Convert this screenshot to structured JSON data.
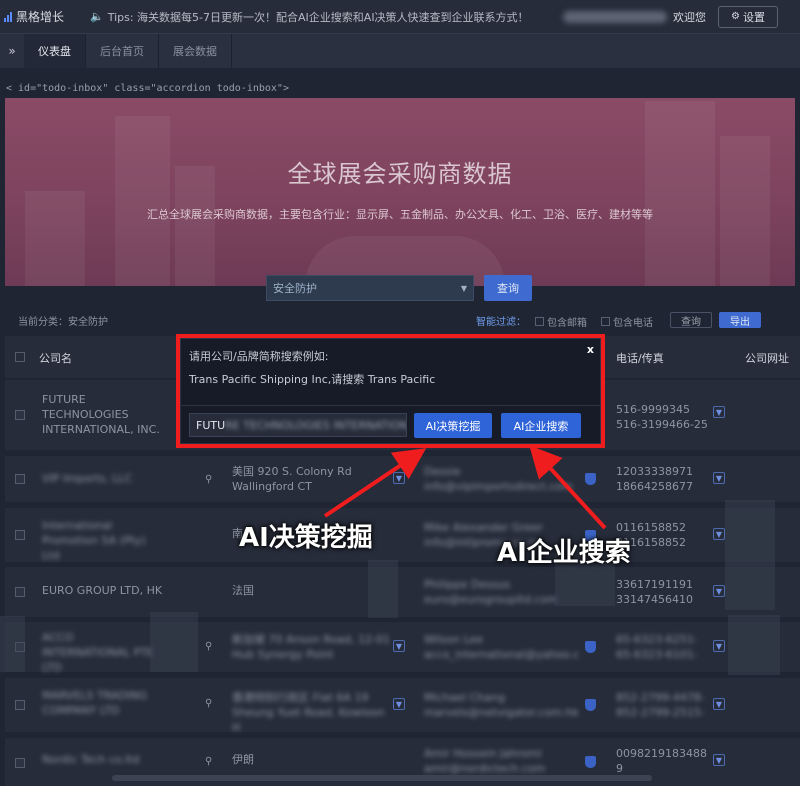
{
  "header": {
    "logo": "黑格增长",
    "tips": "Tips: 海关数据每5-7日更新一次！配合AI企业搜索和AI决策人快速查到企业联系方式！",
    "welcome": "欢迎您",
    "settings_label": "设置"
  },
  "tabs": {
    "toggle": "»",
    "items": [
      {
        "label": "仪表盘"
      },
      {
        "label": "后台首页"
      },
      {
        "label": "展会数据"
      }
    ]
  },
  "code_crumb": "< id=\"todo-inbox\" class=\"accordion todo-inbox\">",
  "banner": {
    "title": "全球展会采购商数据",
    "subtitle": "汇总全球展会采购商数据，主要包含行业：显示屏、五金制品、办公文具、化工、卫浴、医疗、建材等等"
  },
  "search": {
    "selected": "安全防护",
    "query_label": "查询"
  },
  "filter": {
    "current_category": "当前分类：安全防护",
    "smart_filter": "智能过滤：",
    "include_email": "包含邮箱",
    "include_phone": "包含电话",
    "query_label": "查询",
    "export_label": "导出"
  },
  "table": {
    "columns": {
      "company": "公司名",
      "phone": "电话/传真",
      "website": "公司网址"
    },
    "rows": [
      {
        "name": "FUTURE TECHNOLOGIES INTERNATIONAL, INC.",
        "address": "",
        "contact": "",
        "phone": "516-9999345\n516-3199466-25"
      },
      {
        "name": "VIP Imports, LLC",
        "address": "美国   920 S. Colony Rd Wallingford CT",
        "contact": "Dessie\ninfo@vipimportsdirect.com",
        "phone": "12033338971\n18664258677"
      },
      {
        "name": "International Promotion SA (Pty) Ltd",
        "address": "南非",
        "contact": "Mike Alexander Greer\ninfo@intlpromo.co.za",
        "phone": "0116158852\n0116158852"
      },
      {
        "name": "EURO GROUP LTD, HK",
        "address": "法国",
        "contact": "Philippe Dessus\neuro@eurogroupltd.com",
        "phone": "33617191191\n33147456410"
      },
      {
        "name": "ACCO INTERNATIONAL PTE LTD",
        "address": "新加坡   70 Anson Road, 12-01 Hub Synergy Point",
        "contact": "Wilson Lee\nacco_international@yahoo.c",
        "phone": "65-6323-6251-\n65-6323-6101-"
      },
      {
        "name": "MARVELS TRADING COMPANY LTD",
        "address": "香港特别行政区   Flat 6A 19 Sheung Yuet Road, Kowloon H",
        "contact": "Michael Chang\nmarvels@netvigator.com.hk",
        "phone": "852-2799-4478-\n852-2799-2515-"
      },
      {
        "name": "Nordic Tech co.ltd",
        "address": "伊朗",
        "contact": "Amir Hossein Jahromi\namir@nordictech.com",
        "phone": "0098219183488\n9"
      }
    ]
  },
  "dialog": {
    "hint": "请用公司/品牌简称搜索例如:",
    "example": "Trans Pacific Shipping Inc,请搜索 Trans Pacific",
    "close": "x",
    "input_value_visible": "FUTU",
    "input_value_blurred": "RE TECHNOLOGIES INTERNATION",
    "btn_decision": "AI决策挖掘",
    "btn_company": "AI企业搜索"
  },
  "annotations": {
    "left_label": "AI决策挖掘",
    "right_label": "AI企业搜索",
    "color": "#ef1d1d"
  },
  "colors": {
    "accent_blue": "#2f63d8",
    "banner": "#8a4b66",
    "highlight_red": "#ef1d1d"
  }
}
